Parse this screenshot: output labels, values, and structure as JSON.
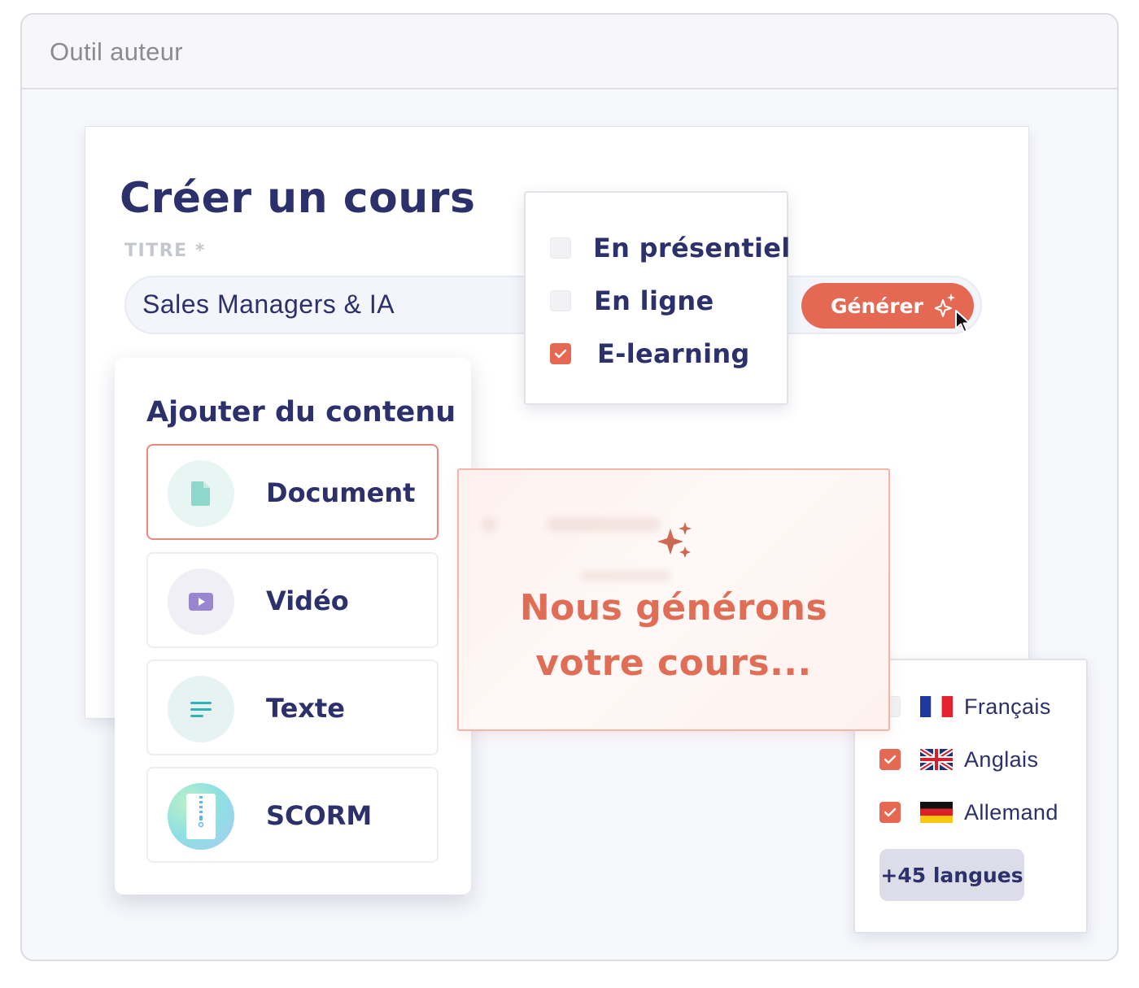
{
  "window": {
    "title": "Outil auteur"
  },
  "course_form": {
    "heading": "Créer un cours",
    "title_label": "TITRE *",
    "title_value": "Sales Managers & IA",
    "generate_label": "Générer"
  },
  "format_options": [
    {
      "label": "En présentiel",
      "checked": false
    },
    {
      "label": "En ligne",
      "checked": false
    },
    {
      "label": "E-learning",
      "checked": true
    }
  ],
  "content_panel": {
    "heading": "Ajouter du contenu",
    "items": [
      {
        "label": "Document",
        "icon": "document-icon",
        "selected": true
      },
      {
        "label": "Vidéo",
        "icon": "video-icon",
        "selected": false
      },
      {
        "label": "Texte",
        "icon": "text-icon",
        "selected": false
      },
      {
        "label": "SCORM",
        "icon": "scorm-archive-icon",
        "selected": false
      }
    ]
  },
  "generation": {
    "line1": "Nous générons",
    "line2": "votre cours..."
  },
  "languages": {
    "items": [
      {
        "label": "Français",
        "flag": "france-flag",
        "checked": false
      },
      {
        "label": "Anglais",
        "flag": "uk-flag",
        "checked": true
      },
      {
        "label": "Allemand",
        "flag": "germany-flag",
        "checked": true
      }
    ],
    "more_label": "+45 langues"
  },
  "colors": {
    "accent": "#e56852",
    "navy": "#2c306b",
    "generation_text": "#e06d55"
  }
}
